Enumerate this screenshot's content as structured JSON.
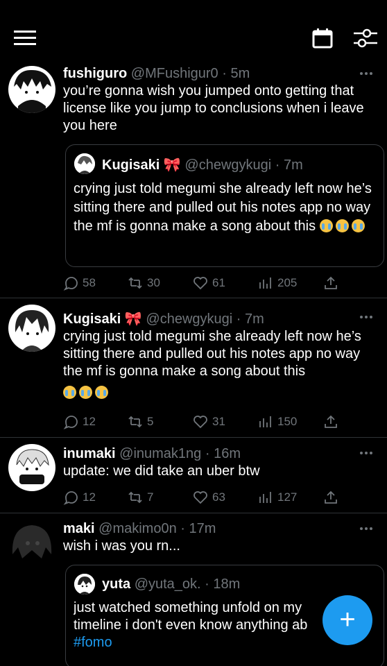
{
  "header": {
    "menu_icon": "hamburger-menu-icon",
    "calendar_icon": "calendar-icon",
    "filter_icon": "sliders-icon"
  },
  "tweets": [
    {
      "name": "fushiguro",
      "handle": "@MFushigur0",
      "time": "· 5m",
      "text": "you’re gonna wish you jumped onto getting that license like you jump to conclusions when i leave you here",
      "quote": {
        "name": "Kugisaki 🎀",
        "handle": "@chewgykugi",
        "time": "· 7m",
        "text": "crying just told megumi she already left now he’s sitting there and pulled out his notes app no way the mf is gonna make a song about this"
      },
      "replies": "58",
      "retweets": "30",
      "likes": "61",
      "views": "205"
    },
    {
      "name": "Kugisaki 🎀",
      "handle": "@chewgykugi",
      "time": "· 7m",
      "text": "crying just told megumi she already left now he’s sitting there and pulled out his notes app no way the mf is gonna make a song about this",
      "replies": "12",
      "retweets": "5",
      "likes": "31",
      "views": "150"
    },
    {
      "name": "inumaki",
      "handle": "@inumak1ng",
      "time": "· 16m",
      "text": "update: we did take an uber btw",
      "replies": "12",
      "retweets": "7",
      "likes": "63",
      "views": "127"
    },
    {
      "name": "maki",
      "handle": "@makimo0n",
      "time": "· 17m",
      "text": "wish i was you rn...",
      "quote": {
        "name": "yuta",
        "handle": "@yuta_ok.",
        "time": "· 18m",
        "text": "just watched something unfold on my timeline i don't even know anything ab",
        "hashtag": "#fomo"
      }
    }
  ],
  "fab": {
    "label": "+"
  },
  "colors": {
    "accent": "#1d9bf0",
    "background": "#000000",
    "muted": "#71767b"
  }
}
